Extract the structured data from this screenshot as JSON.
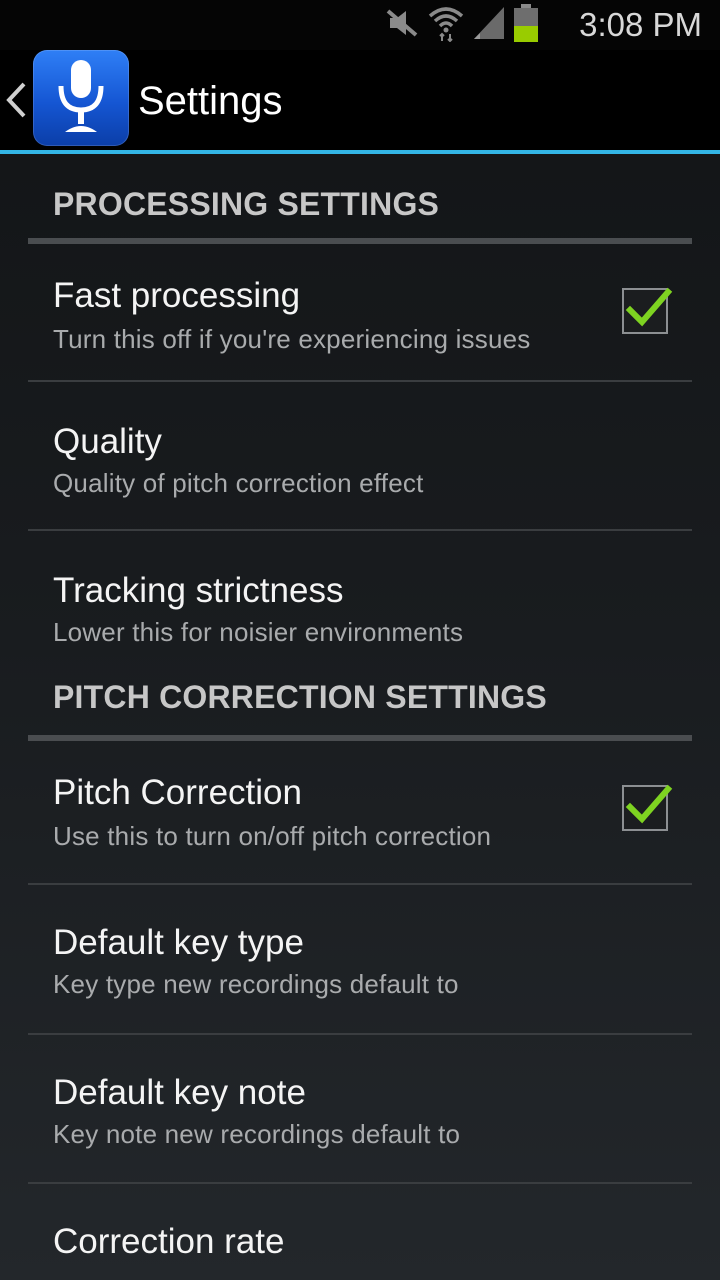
{
  "status_bar": {
    "time": "3:08 PM",
    "icons": [
      "mute-icon",
      "wifi-icon",
      "signal-icon",
      "battery-icon"
    ]
  },
  "action_bar": {
    "title": "Settings",
    "app_icon": "microphone-icon",
    "accent_color": "#33b5e5"
  },
  "processing": {
    "header": "PROCESSING SETTINGS",
    "fast": {
      "title": "Fast processing",
      "summary": "Turn this off if you're experiencing issues",
      "checked": true
    },
    "quality": {
      "title": "Quality",
      "summary": "Quality of pitch correction effect"
    },
    "tracking": {
      "title": "Tracking strictness",
      "summary": "Lower this for noisier environments"
    }
  },
  "pitch": {
    "header": "PITCH CORRECTION SETTINGS",
    "correction": {
      "title": "Pitch Correction",
      "summary": "Use this to turn on/off pitch correction",
      "checked": true
    },
    "key_type": {
      "title": "Default key type",
      "summary": "Key type new recordings default to"
    },
    "key_note": {
      "title": "Default key note",
      "summary": "Key note new recordings default to"
    },
    "rate": {
      "title": "Correction rate"
    }
  },
  "colors": {
    "check_green": "#7ed321",
    "battery_green": "#99cc00"
  }
}
